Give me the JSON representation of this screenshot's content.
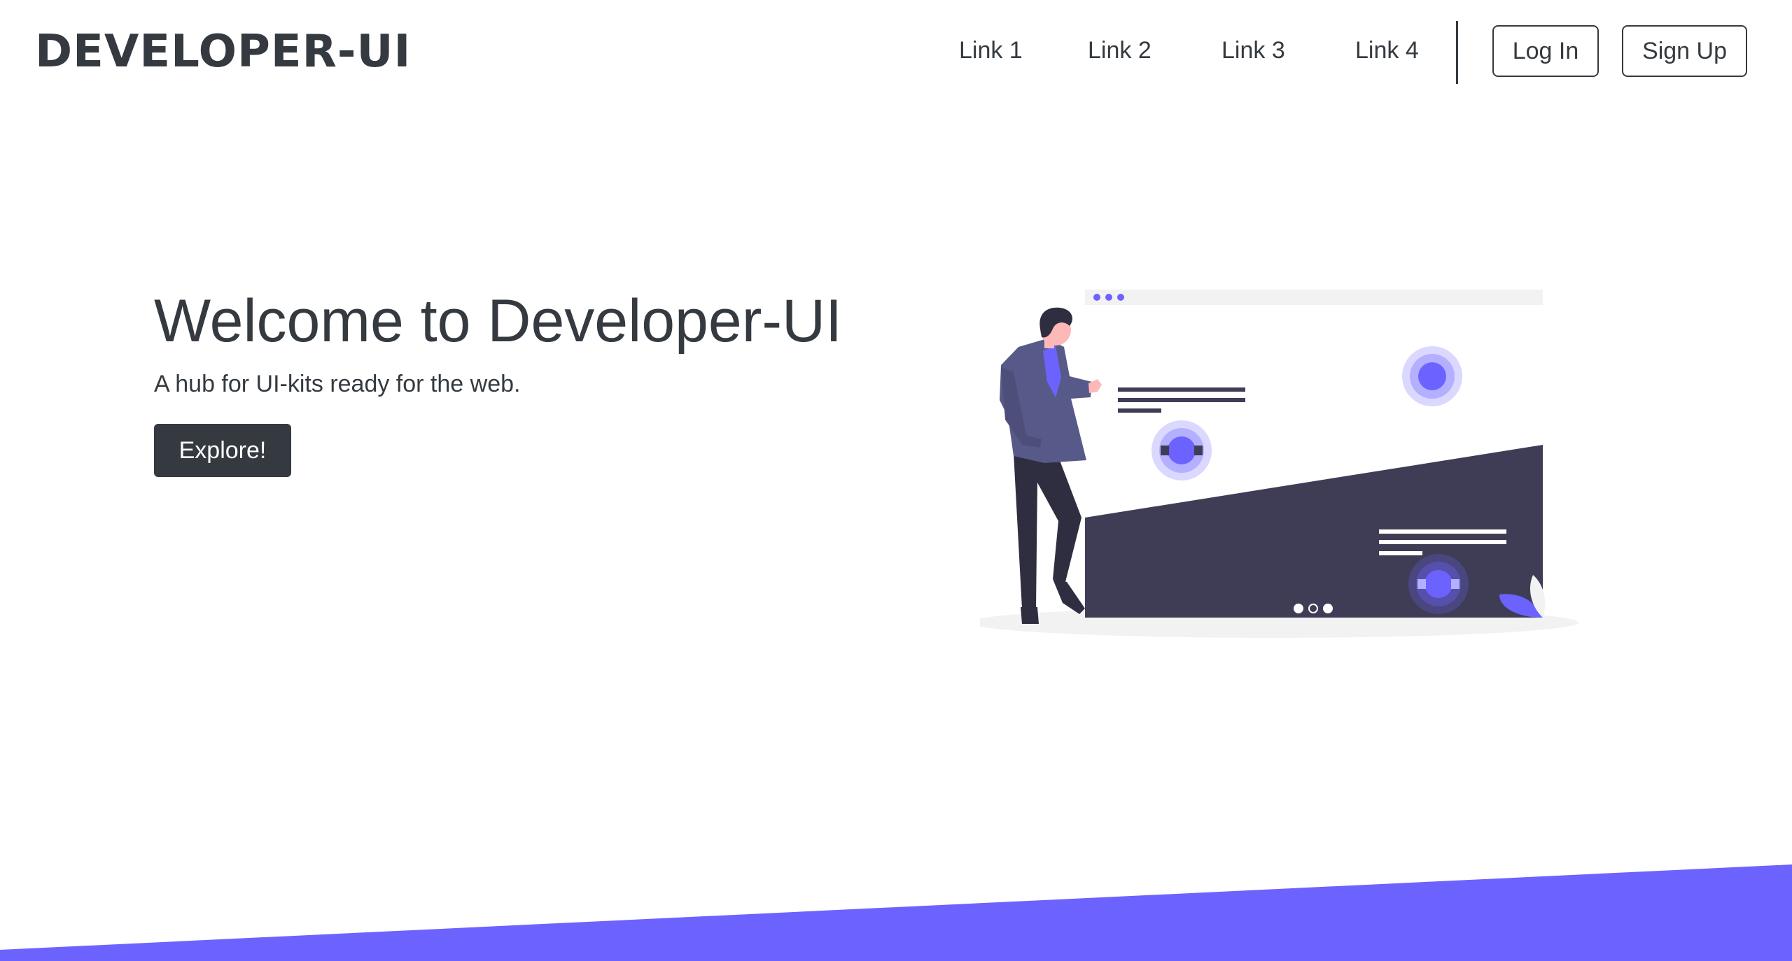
{
  "brand": "DEVELOPER-UI",
  "nav": {
    "links": [
      "Link 1",
      "Link 2",
      "Link 3",
      "Link 4"
    ],
    "login_label": "Log In",
    "signup_label": "Sign Up"
  },
  "hero": {
    "title": "Welcome to Developer-UI",
    "subtitle": "A hub for UI-kits ready for the web.",
    "cta_label": "Explore!"
  },
  "colors": {
    "primary_text": "#343a40",
    "accent": "#6c63ff",
    "dark_panel": "#3f3d56",
    "light_gray": "#f2f2f2",
    "skin": "#ffb8b8",
    "hair": "#2f2e41"
  }
}
